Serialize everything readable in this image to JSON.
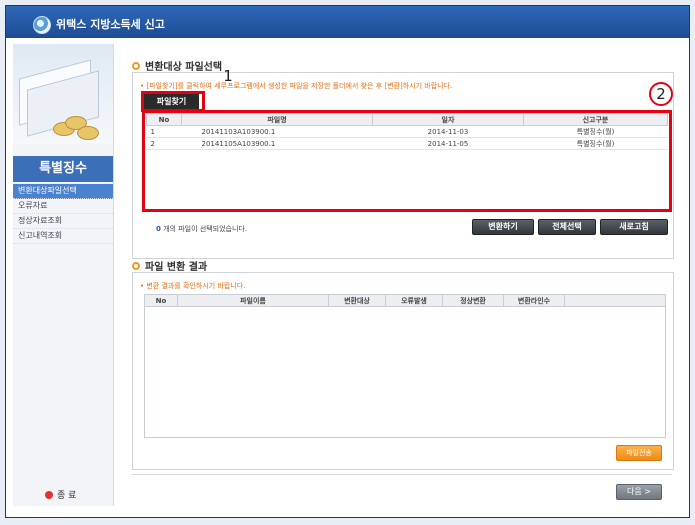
{
  "window": {
    "title": "위택스 지방소득세 신고"
  },
  "sidebar": {
    "section_title": "특별징수",
    "items": [
      {
        "label": "변환대상파일선택",
        "active": true
      },
      {
        "label": "오류자료",
        "active": false
      },
      {
        "label": "정상자료조회",
        "active": false
      },
      {
        "label": "신고내역조회",
        "active": false
      }
    ],
    "exit_label": "종 료"
  },
  "upload": {
    "heading": "변환대상 파일선택",
    "note": "• [파일찾기]를 클릭하여 세무프로그램에서 생성한 파일을 저장한 폴더에서 찾은 후 [변환]하시기 바랍니다.",
    "find_button": "파일찾기",
    "columns": [
      "No",
      "파일명",
      "일자",
      "신고구분"
    ],
    "rows": [
      [
        "1",
        "20141103A103900.1",
        "2014-11-03",
        "특별징수(월)"
      ],
      [
        "2",
        "20141105A103900.1",
        "2014-11-05",
        "특별징수(월)"
      ]
    ],
    "selected_count": "0",
    "selected_text": "개의 파일이 선택되었습니다.",
    "buttons": {
      "convert": "변환하기",
      "select_all": "전체선택",
      "refresh": "새로고침"
    }
  },
  "result": {
    "heading": "파일 변환 결과",
    "note": "• 변환 결과를 확인하시기 바랍니다.",
    "columns": [
      "No",
      "파일이름",
      "변환대상",
      "오류발생",
      "정상변환",
      "변환라인수"
    ],
    "send_button": "파일전송"
  },
  "next_button": "다음 >",
  "callouts": [
    "1",
    "2"
  ],
  "colors": {
    "title_bar": "#1d4c94",
    "highlight_red": "#e50012",
    "accent_orange": "#f08a17",
    "active_menu": "#4b82cf"
  }
}
